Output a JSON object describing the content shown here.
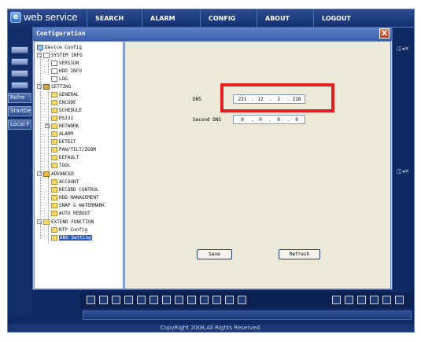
{
  "app": {
    "title": "web service"
  },
  "nav": [
    {
      "label": "SEARCH"
    },
    {
      "label": "ALARM"
    },
    {
      "label": "CONFIG"
    },
    {
      "label": "ABOUT"
    },
    {
      "label": "LOGOUT"
    }
  ],
  "left_panel": {
    "refresh": "Refre",
    "start": "StartDe",
    "local": "Local F"
  },
  "copyright": "CopyRight 2008,All Rights Reserved.",
  "dialog": {
    "title": "Configuration",
    "close_label": "X",
    "tree": {
      "device_config": "Device Config",
      "system_info": "SYSTEM INFO",
      "version": "VERSION",
      "hdd_info": "HDD INFO",
      "log": "LOG",
      "setting": "SETTING",
      "general": "GENERAL",
      "encode": "ENCODE",
      "schedule": "SCHEDULE",
      "rs232": "RS232",
      "network": "NETWORK",
      "alarm": "ALARM",
      "detect": "DETECT",
      "pan_tilt_zoom": "PAN/TILT/ZOOM",
      "default": "DEFAULT",
      "tool": "TOOL",
      "advanced": "ADVANCED",
      "account": "ACCOUNT",
      "record_control": "RECORD CONTROL",
      "hdd_management": "HDD MANAGEMENT",
      "snap_watermark": "SNAP & WATERMARK",
      "auto_reboot": "AUTO REBOOT",
      "extend_function": "EXTEND FUNCTION",
      "ntp_config": "NTP Config",
      "dns_setting": "DNS Setting"
    },
    "content": {
      "dns_label": "DNS",
      "dns": [
        "221",
        "12",
        "1",
        "228"
      ],
      "second_dns_label": "Second DNS",
      "second_dns": [
        "0",
        "0",
        "0",
        "0"
      ],
      "save": "Save",
      "refresh": "Refresh"
    }
  },
  "colors": {
    "highlight": "#e41f1f",
    "dialog_bg": "#ece9d8",
    "frame": "#0f2a63"
  }
}
